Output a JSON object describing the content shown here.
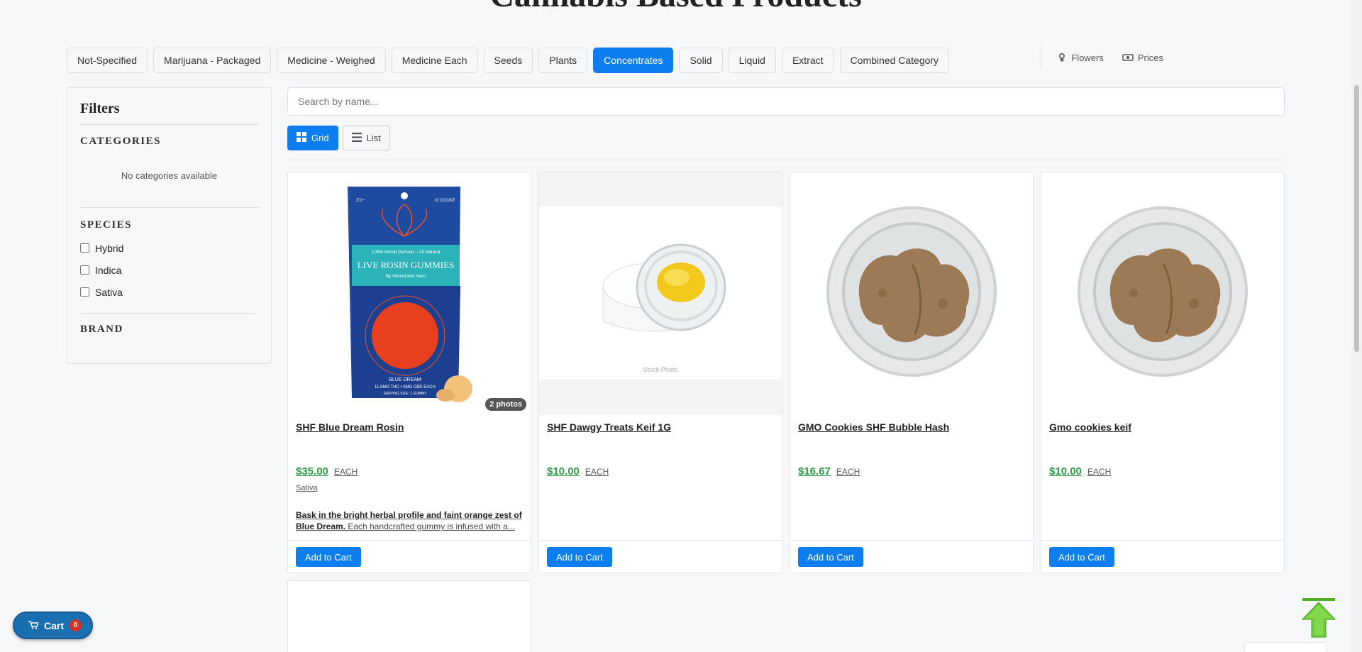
{
  "page": {
    "title": "Cannabis Based Products"
  },
  "categories": [
    {
      "label": "Not-Specified",
      "active": false
    },
    {
      "label": "Marijuana - Packaged",
      "active": false
    },
    {
      "label": "Medicine - Weighed",
      "active": false
    },
    {
      "label": "Medicine Each",
      "active": false
    },
    {
      "label": "Seeds",
      "active": false
    },
    {
      "label": "Plants",
      "active": false
    },
    {
      "label": "Concentrates",
      "active": true
    },
    {
      "label": "Solid",
      "active": false
    },
    {
      "label": "Liquid",
      "active": false
    },
    {
      "label": "Extract",
      "active": false
    },
    {
      "label": "Combined Category",
      "active": false
    }
  ],
  "top_links": {
    "flowers": "Flowers",
    "prices": "Prices"
  },
  "filters": {
    "title": "Filters",
    "categories_title": "CATEGORIES",
    "categories_empty": "No categories available",
    "species_title": "SPECIES",
    "species": [
      "Hybrid",
      "Indica",
      "Sativa"
    ],
    "brand_title": "BRAND"
  },
  "search": {
    "placeholder": "Search by name..."
  },
  "view": {
    "grid": "Grid",
    "list": "List",
    "active": "grid"
  },
  "products": [
    {
      "name": "SHF Blue Dream Rosin",
      "price": "$35.00",
      "unit": "EACH",
      "species": "Sativa",
      "desc_bold": "Bask in the bright herbal profile and faint orange zest of Blue Dream.",
      "desc_rest": " Each handcrafted gummy is infused with a...",
      "photos": "2 photos",
      "image": "gummies-pouch",
      "pouch_text": {
        "age": "21+",
        "count": "10 COUNT",
        "brand_line": "100% Hemp Derived – All Natural",
        "product": "LIVE ROSIN GUMMIES",
        "maker": "By Hometown Hero",
        "strain": "BLUE DREAM",
        "dose": "11.5MG THC • 3MG CBD EACH",
        "serving": "SERVING SIZE: 1 GUMMY"
      },
      "add_label": "Add to Cart"
    },
    {
      "name": "SHF Dawgy Treats Keif 1G",
      "price": "$10.00",
      "unit": "EACH",
      "image": "concentrate-jar",
      "image_caption": "Stock Photo",
      "add_label": "Add to Cart"
    },
    {
      "name": "GMO Cookies SHF Bubble Hash",
      "price": "$16.67",
      "unit": "EACH",
      "image": "hash-dish",
      "add_label": "Add to Cart"
    },
    {
      "name": "Gmo cookies keif",
      "price": "$10.00",
      "unit": "EACH",
      "image": "hash-dish",
      "add_label": "Add to Cart"
    }
  ],
  "cart": {
    "label": "Cart",
    "count": "0"
  },
  "colors": {
    "accent": "#0d7ef0",
    "price": "#2e9b47",
    "cart": "#1a6fb0",
    "badge": "#d93025"
  }
}
